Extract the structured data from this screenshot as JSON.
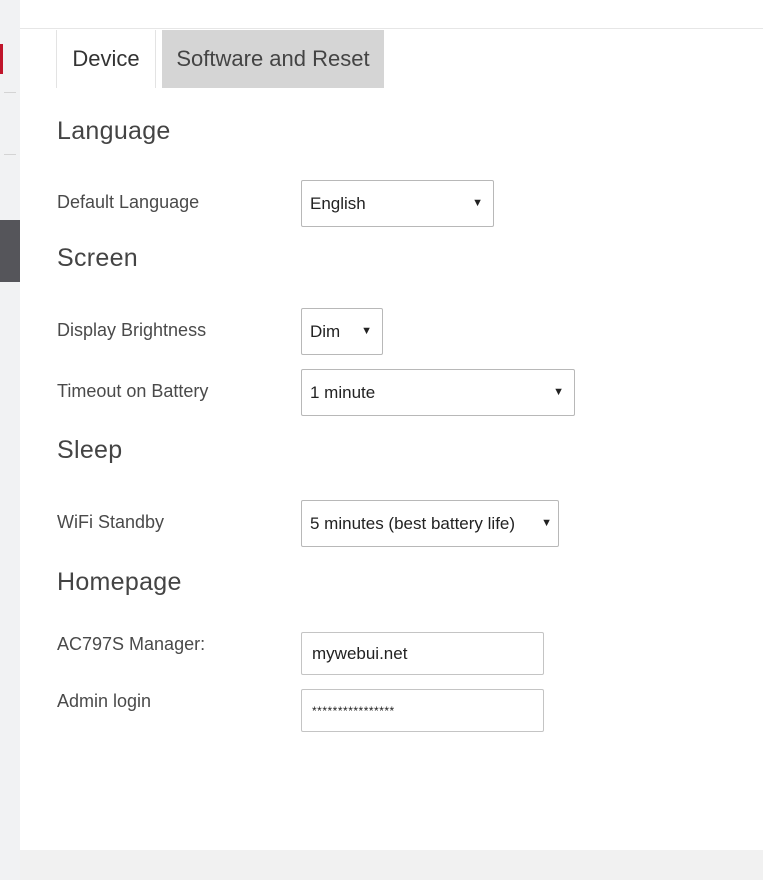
{
  "tabs": {
    "device": "Device",
    "software": "Software and Reset"
  },
  "language": {
    "heading": "Language",
    "default_language": {
      "label": "Default Language",
      "value": "English"
    }
  },
  "screen": {
    "heading": "Screen",
    "brightness": {
      "label": "Display Brightness",
      "value": "Dim"
    },
    "timeout": {
      "label": "Timeout on Battery",
      "value": "1 minute"
    }
  },
  "sleep": {
    "heading": "Sleep",
    "wifi_standby": {
      "label": "WiFi Standby",
      "value": "5 minutes (best battery life)"
    }
  },
  "homepage": {
    "heading": "Homepage",
    "manager": {
      "label": "AC797S Manager:",
      "value": "mywebui.net"
    },
    "admin": {
      "label": "Admin login",
      "value": "****************"
    }
  },
  "colors": {
    "accent_red": "#c0152a",
    "inactive_tab": "#d5d5d5",
    "sidebar_dark": "#55555a"
  },
  "icons": {
    "dropdown": "caret-down-icon"
  }
}
